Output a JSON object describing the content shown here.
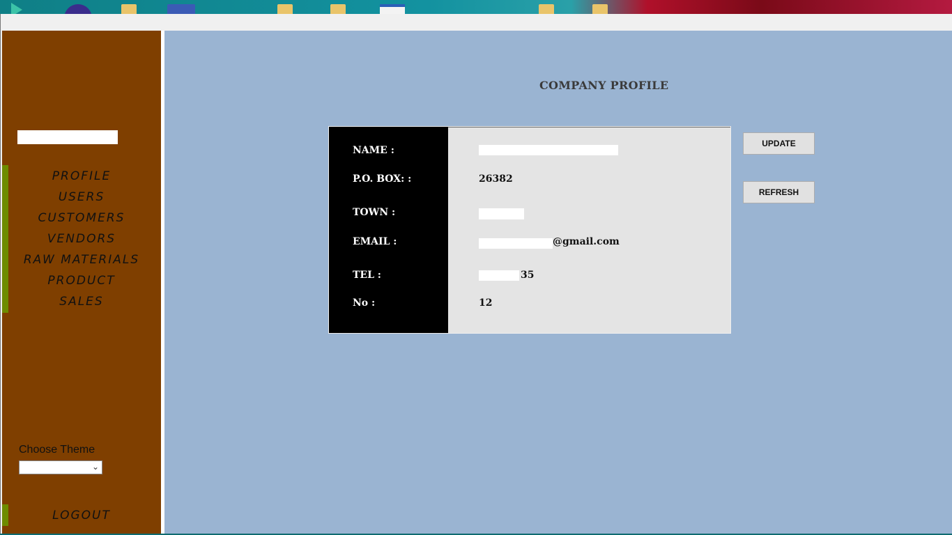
{
  "window": {
    "title": ""
  },
  "sidebar": {
    "items": [
      {
        "label": "PROFILE"
      },
      {
        "label": "USERS"
      },
      {
        "label": "CUSTOMERS"
      },
      {
        "label": "VENDORS"
      },
      {
        "label": "RAW MATERIALS"
      },
      {
        "label": "PRODUCT"
      },
      {
        "label": "SALES"
      }
    ],
    "theme_label": "Choose Theme",
    "theme_value": "",
    "logout_label": "LOGOUT"
  },
  "main": {
    "title": "COMPANY PROFILE",
    "fields": [
      {
        "label": "NAME :",
        "value": ""
      },
      {
        "label": "P.O. BOX: :",
        "value": "26382"
      },
      {
        "label": "TOWN :",
        "value": ""
      },
      {
        "label": "EMAIL :",
        "value": "@gmail.com"
      },
      {
        "label": "TEL :",
        "value": "35"
      },
      {
        "label": "No :",
        "value": "12"
      }
    ],
    "buttons": {
      "update": "UPDATE",
      "refresh": "REFRESH"
    }
  },
  "colors": {
    "sidebar_bg": "#7f3f00",
    "sidebar_accent": "#6e8b00",
    "main_bg": "#9ab4d2",
    "label_panel": "#000000",
    "value_panel": "#e4e4e4"
  }
}
